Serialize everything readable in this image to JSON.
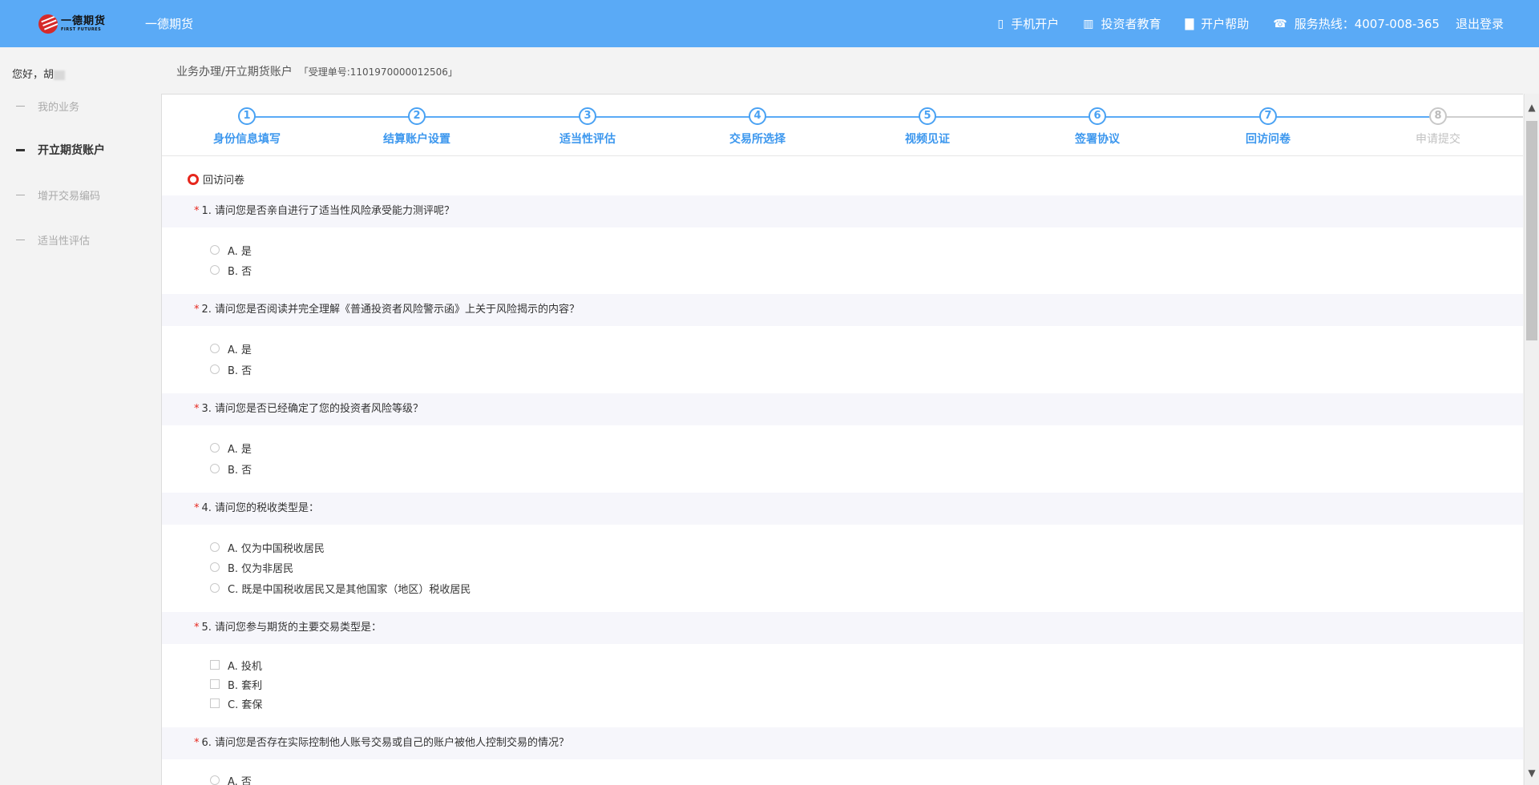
{
  "header": {
    "logo_cn": "一德期货",
    "logo_en": "FIRST FUTURES",
    "company": "一德期货",
    "nav": {
      "mobile": "手机开户",
      "education": "投资者教育",
      "help": "开户帮助",
      "hotline": "服务热线：4007-008-365",
      "logout": "退出登录"
    }
  },
  "sidebar": {
    "greeting": "您好，胡",
    "items": [
      "我的业务",
      "开立期货账户",
      "增开交易编码",
      "适当性评估"
    ]
  },
  "breadcrumb": {
    "path": "业务办理/开立期货账户",
    "ticket": "「受理单号:1101970000012506」"
  },
  "steps": [
    {
      "num": "1",
      "label": "身份信息填写"
    },
    {
      "num": "2",
      "label": "结算账户设置"
    },
    {
      "num": "3",
      "label": "适当性评估"
    },
    {
      "num": "4",
      "label": "交易所选择"
    },
    {
      "num": "5",
      "label": "视频见证"
    },
    {
      "num": "6",
      "label": "签署协议"
    },
    {
      "num": "7",
      "label": "回访问卷"
    },
    {
      "num": "8",
      "label": "申请提交"
    }
  ],
  "section_title": "回访问卷",
  "questions": [
    {
      "star": "*",
      "text": "1. 请问您是否亲自进行了适当性风险承受能力测评呢？",
      "options": [
        "A. 是",
        "B. 否"
      ]
    },
    {
      "star": "*",
      "text": "2. 请问您是否阅读并完全理解《普通投资者风险警示函》上关于风险揭示的内容？",
      "options": [
        "A. 是",
        "B. 否"
      ]
    },
    {
      "star": "*",
      "text": "3. 请问您是否已经确定了您的投资者风险等级？",
      "options": [
        "A. 是",
        "B. 否"
      ]
    },
    {
      "star": "*",
      "text": "4. 请问您的税收类型是：",
      "options": [
        "A. 仅为中国税收居民",
        "B. 仅为非居民",
        "C. 既是中国税收居民又是其他国家（地区）税收居民"
      ]
    },
    {
      "star": "*",
      "text": "5. 请问您参与期货的主要交易类型是：",
      "options": [
        "A. 投机",
        "B. 套利",
        "C. 套保"
      ]
    },
    {
      "star": "*",
      "text": "6. 请问您是否存在实际控制他人账号交易或自己的账户被他人控制交易的情况？",
      "options": [
        "A. 否"
      ]
    }
  ],
  "colors": {
    "header_bg": "#5aaaf6",
    "step_active": "#4aa2f3",
    "step_disabled": "#c8c8c8",
    "required_star": "#e6271d"
  }
}
